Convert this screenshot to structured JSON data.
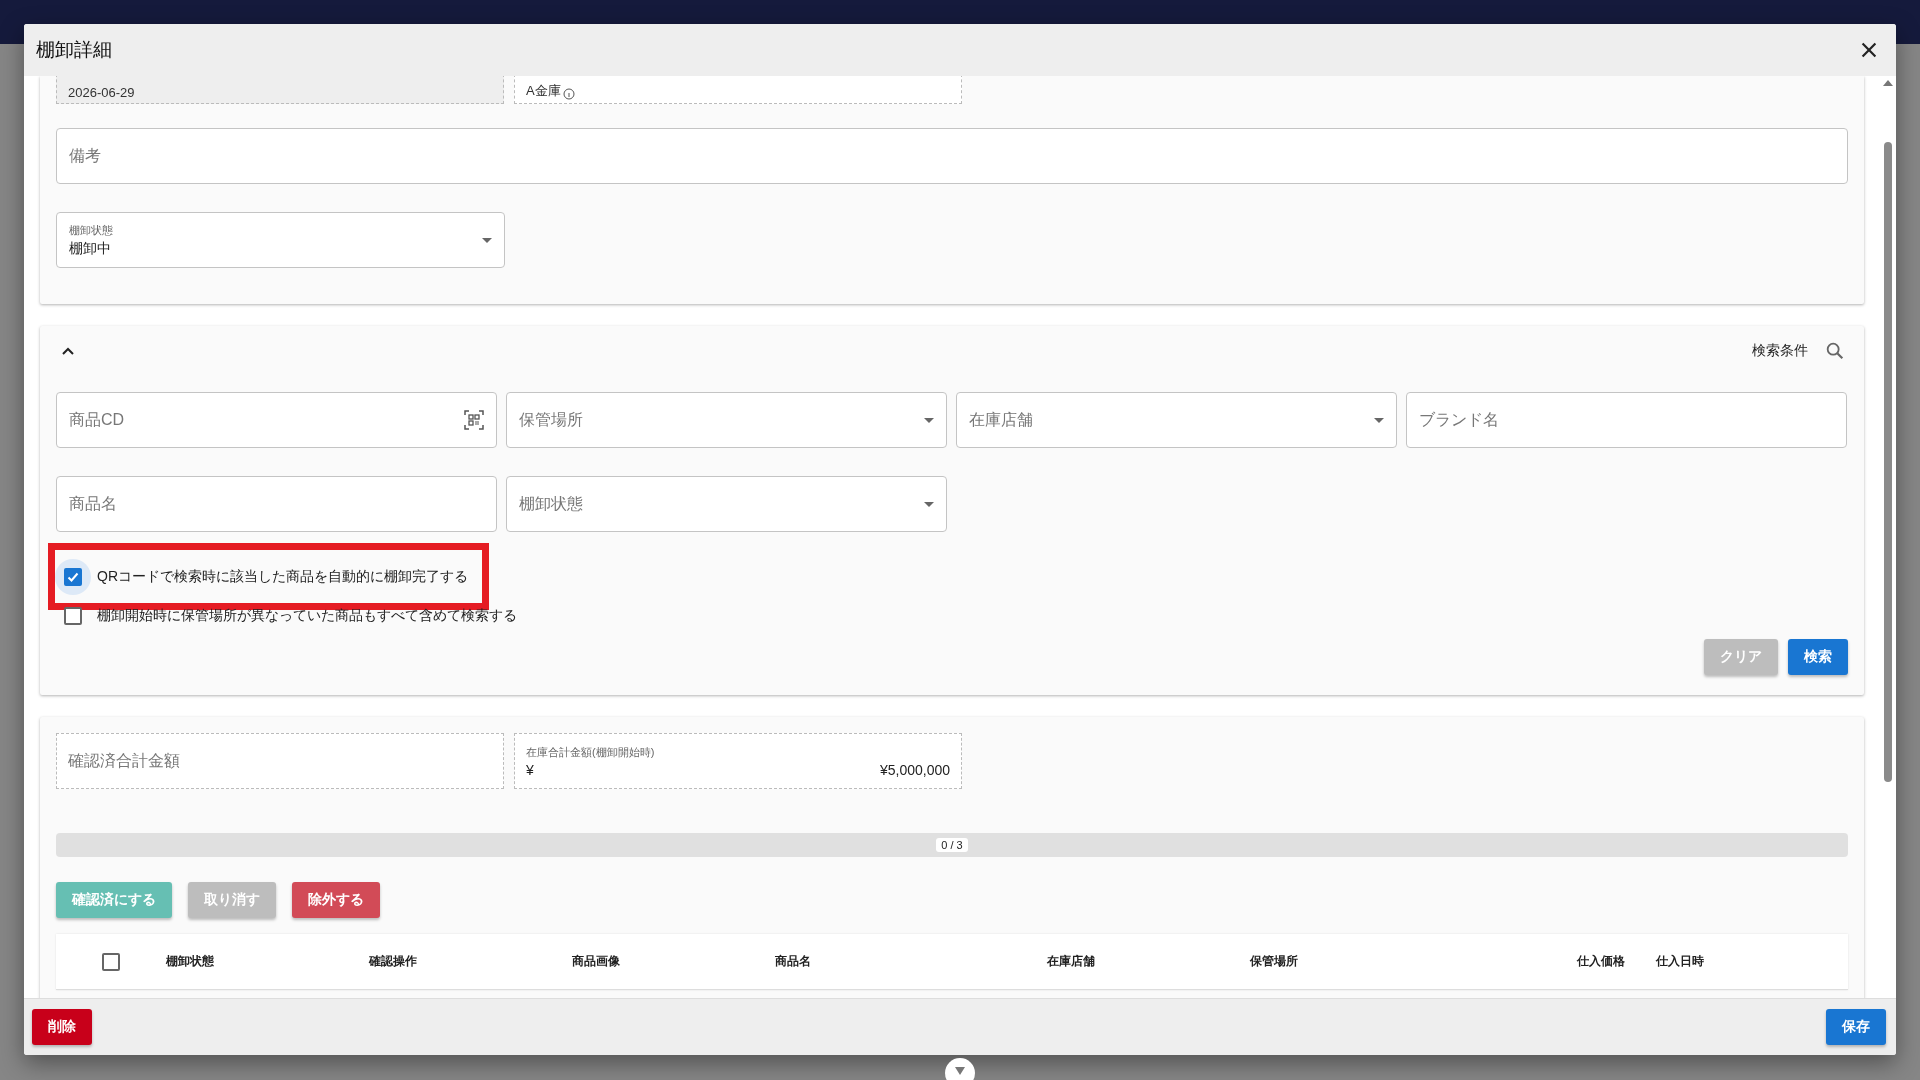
{
  "dialog": {
    "title": "棚卸詳細"
  },
  "detail": {
    "fields": [
      {
        "value": "2026-06-29",
        "kind": "readonly"
      },
      {
        "value": "A金庫",
        "kind": "info"
      }
    ],
    "remarks": {
      "placeholder": "備考"
    },
    "status": {
      "label": "棚卸状態",
      "value": "棚卸中"
    }
  },
  "search": {
    "expanded": true,
    "title": "検索条件",
    "fields": [
      {
        "placeholder": "商品CD",
        "kind": "scan"
      },
      {
        "placeholder": "保管場所",
        "kind": "select"
      },
      {
        "placeholder": "在庫店舗",
        "kind": "select"
      },
      {
        "placeholder": "ブランド名",
        "kind": "text"
      },
      {
        "placeholder": "商品名",
        "kind": "text"
      },
      {
        "placeholder": "棚卸状態",
        "kind": "select"
      }
    ],
    "options": [
      {
        "label": "QRコードで検索時に該当した商品を自動的に棚卸完了する",
        "checked": true,
        "highlighted": true
      },
      {
        "label": "棚卸開始時に保管場所が異なっていた商品もすべて含めて検索する",
        "checked": false,
        "highlighted": false
      }
    ],
    "buttons": [
      {
        "label": "クリア",
        "kind": "secondary"
      },
      {
        "label": "検索",
        "kind": "primary"
      }
    ]
  },
  "totals": {
    "fields": [
      {
        "placeholder": "確認済合計金額"
      },
      {
        "label": "在庫合計金額(棚卸開始時)",
        "prefix": "¥",
        "value": "¥5,000,000"
      }
    ],
    "progress": {
      "level": 0,
      "reading": "0 / 3"
    },
    "actions": [
      {
        "label": "確認済にする",
        "kind": "confirm"
      },
      {
        "label": "取り消す",
        "kind": "cancel"
      },
      {
        "label": "除外する",
        "kind": "exclude"
      }
    ],
    "table": {
      "all_selected": false,
      "columns": [
        "棚卸状態",
        "確認操作",
        "商品画像",
        "商品名",
        "在庫店舗",
        "保管場所",
        "仕入価格",
        "仕入日時"
      ]
    }
  },
  "footer": {
    "delete": "削除",
    "save": "保存"
  }
}
